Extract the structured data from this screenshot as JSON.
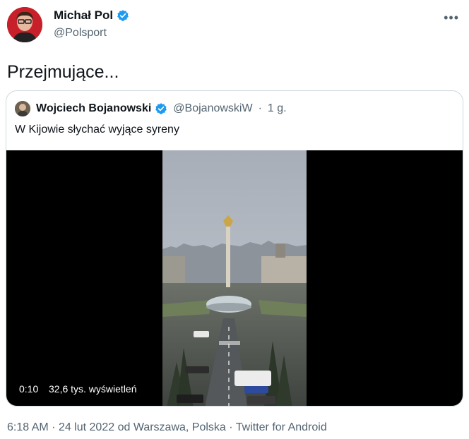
{
  "tweet": {
    "author_name": "Michał Pol",
    "author_handle": "@Polsport",
    "text": "Przejmujące...",
    "more_icon": "more-horizontal-icon"
  },
  "quoted": {
    "author_name": "Wojciech Bojanowski",
    "author_handle": "@BojanowskiW",
    "separator": "·",
    "age": "1 g.",
    "text": "W Kijowie słychać wyjące syreny",
    "video": {
      "elapsed": "0:10",
      "views": "32,6 tys. wyświetleń"
    }
  },
  "footer": {
    "time": "6:18 AM",
    "sep1": "·",
    "date": "24 lut 2022",
    "location": "od Warszawa, Polska",
    "sep2": "·",
    "source": "Twitter for Android"
  },
  "colors": {
    "verified": "#1d9bf0",
    "text_primary": "#0f1419",
    "text_secondary": "#536471",
    "border": "#cfd9de",
    "video_background": "#000000"
  }
}
